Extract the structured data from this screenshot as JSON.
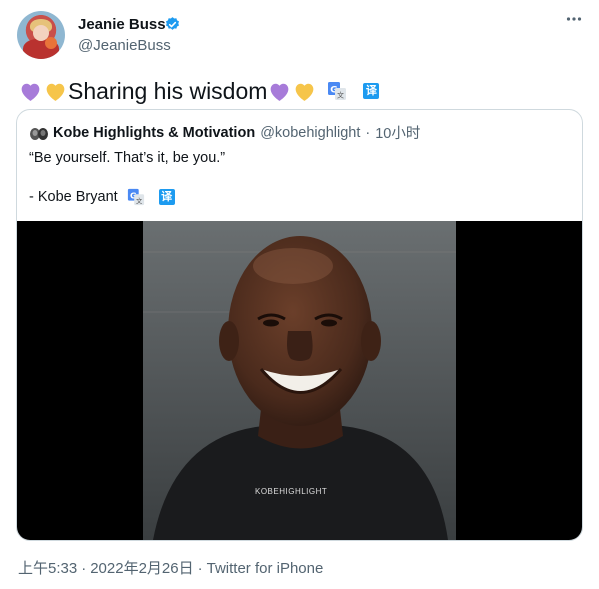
{
  "author": {
    "name": "Jeanie Buss",
    "handle": "@JeanieBuss",
    "verified": true
  },
  "tweet": {
    "text": "Sharing his wisdom",
    "leading_emojis": [
      "purple-heart",
      "yellow-heart"
    ],
    "trailing_emojis": [
      "purple-heart",
      "yellow-heart"
    ],
    "translate_label": "译"
  },
  "quote": {
    "name": "Kobe Highlights & Motivation",
    "handle": "@kobehighlight",
    "separator": "·",
    "time": "10小时",
    "line1": "“Be yourself. That’s it, be you.”",
    "line2": "- Kobe Bryant",
    "translate_label": "译",
    "watermark": "KOBEHIGHLIGHT"
  },
  "footer": {
    "time": "上午5:33",
    "date": "2022年2月26日",
    "source": "Twitter for iPhone",
    "separator": "·"
  },
  "colors": {
    "accent": "#1d9bf0",
    "secondary_text": "#536471",
    "border": "#cfd9de"
  }
}
